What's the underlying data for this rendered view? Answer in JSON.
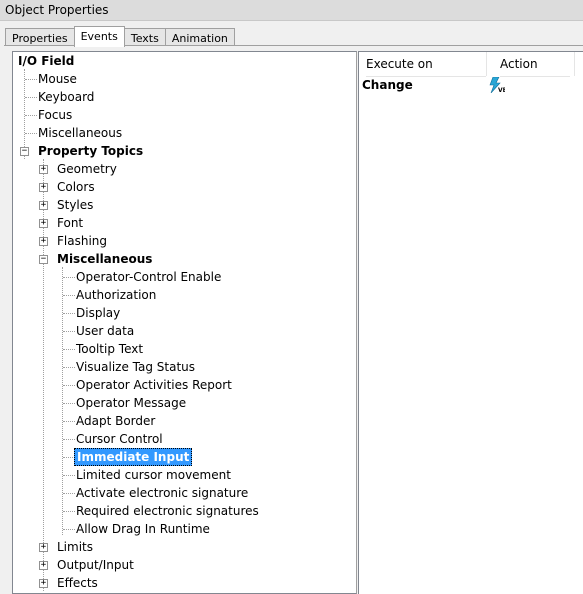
{
  "window": {
    "title": "Object Properties"
  },
  "tabs": [
    {
      "label": "Properties",
      "active": false
    },
    {
      "label": "Events",
      "active": true
    },
    {
      "label": "Texts",
      "active": false
    },
    {
      "label": "Animation",
      "active": false
    }
  ],
  "tree": {
    "root": "I/O Field",
    "root_items": [
      "Mouse",
      "Keyboard",
      "Focus",
      "Miscellaneous"
    ],
    "property_topics": {
      "label": "Property Topics",
      "children": [
        "Geometry",
        "Colors",
        "Styles",
        "Font",
        "Flashing"
      ],
      "misc": {
        "label": "Miscellaneous",
        "children": [
          "Operator-Control Enable",
          "Authorization",
          "Display",
          "User data",
          "Tooltip Text",
          "Visualize Tag Status",
          "Operator Activities Report",
          "Operator Message",
          "Adapt Border",
          "Cursor Control",
          "Immediate Input",
          "Limited cursor movement",
          "Activate electronic signature",
          "Required electronic signatures",
          "Allow Drag In Runtime"
        ],
        "selected": "Immediate Input"
      },
      "after": [
        "Limits",
        "Output/Input",
        "Effects"
      ]
    }
  },
  "events": {
    "columns": [
      "Execute on",
      "Action"
    ],
    "rows": [
      {
        "trigger": "Change",
        "action_icon": "vb-script-lightning-icon"
      }
    ]
  }
}
